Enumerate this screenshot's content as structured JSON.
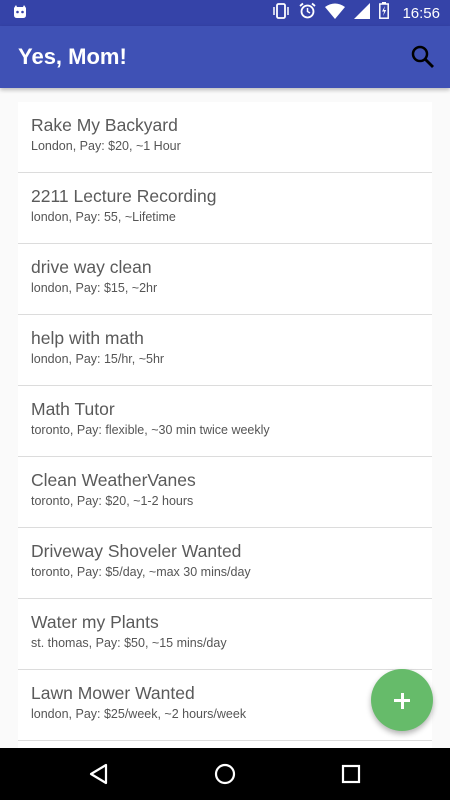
{
  "status_bar": {
    "time": "16:56",
    "icons": [
      "android-debug-icon",
      "vibrate-icon",
      "alarm-icon",
      "wifi-icon",
      "signal-icon",
      "battery-icon"
    ]
  },
  "app_bar": {
    "title": "Yes, Mom!",
    "search_icon": "search-icon"
  },
  "jobs": [
    {
      "title": "Rake My Backyard",
      "details": "London, Pay: $20, ~1 Hour"
    },
    {
      "title": "2211 Lecture Recording",
      "details": "london, Pay: 55, ~Lifetime"
    },
    {
      "title": "drive way clean",
      "details": "london, Pay: $15, ~2hr"
    },
    {
      "title": "help with math",
      "details": "london, Pay: 15/hr, ~5hr"
    },
    {
      "title": "Math Tutor",
      "details": "toronto, Pay: flexible, ~30 min twice weekly"
    },
    {
      "title": "Clean WeatherVanes",
      "details": "toronto, Pay: $20, ~1-2 hours"
    },
    {
      "title": "Driveway Shoveler Wanted",
      "details": "toronto, Pay: $5/day, ~max 30 mins/day"
    },
    {
      "title": "Water my Plants",
      "details": "st. thomas, Pay: $50, ~15 mins/day"
    },
    {
      "title": "Lawn Mower Wanted",
      "details": "london, Pay: $25/week, ~2 hours/week"
    }
  ],
  "fab": {
    "icon": "plus-icon"
  },
  "nav_bar": {
    "icons": [
      "back-icon",
      "home-icon",
      "recents-icon"
    ]
  },
  "colors": {
    "status_bar": "#3543a8",
    "app_bar": "#3f51b5",
    "fab": "#66bb6a",
    "background": "#fafafa"
  }
}
